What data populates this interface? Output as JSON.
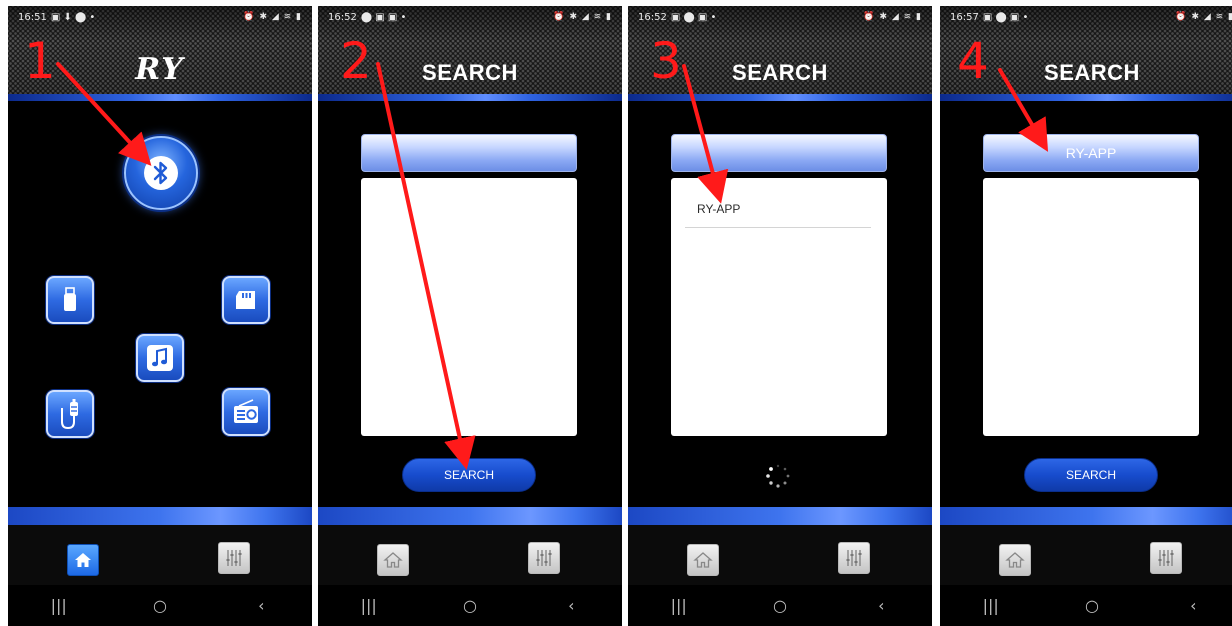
{
  "screens": [
    {
      "status": {
        "time": "16:51"
      },
      "header_title": "RY",
      "step": "1",
      "home_active": true
    },
    {
      "status": {
        "time": "16:52"
      },
      "header_title": "SEARCH",
      "step": "2",
      "device_header": "",
      "devices": [],
      "search_label": "SEARCH"
    },
    {
      "status": {
        "time": "16:52"
      },
      "header_title": "SEARCH",
      "step": "3",
      "device_header": "",
      "devices": [
        "RY-APP"
      ],
      "searching": true
    },
    {
      "status": {
        "time": "16:57"
      },
      "header_title": "SEARCH",
      "step": "4",
      "device_header": "RY-APP",
      "devices": [],
      "search_label": "SEARCH"
    }
  ],
  "icons": {
    "bluetooth": "bluetooth-icon",
    "usb": "usb-drive-icon",
    "sd": "sd-card-icon",
    "music": "music-note-icon",
    "aux": "aux-cable-icon",
    "radio": "radio-icon",
    "home": "home-icon",
    "equalizer": "equalizer-icon"
  },
  "colors": {
    "accent_blue": "#2565dd",
    "annotation_red": "#ff1a1a",
    "header_bar": "#2e62e0"
  }
}
